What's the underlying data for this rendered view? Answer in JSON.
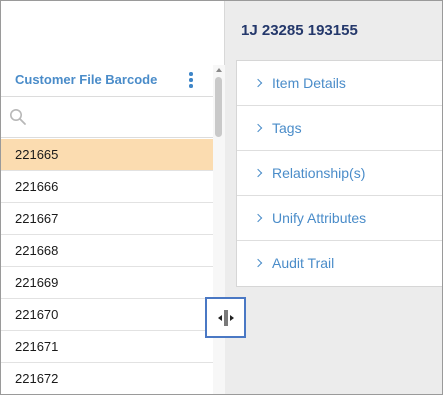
{
  "left_panel": {
    "column_title": "Customer File Barcode",
    "search": {
      "placeholder": "",
      "value": ""
    },
    "rows": [
      "221665",
      "221666",
      "221667",
      "221668",
      "221669",
      "221670",
      "221671",
      "221672"
    ],
    "selected_index": 0
  },
  "right_panel": {
    "record_title": "1J 23285 193155",
    "sections": [
      {
        "label": "Item Details"
      },
      {
        "label": "Tags"
      },
      {
        "label": "Relationship(s)"
      },
      {
        "label": "Unify Attributes"
      },
      {
        "label": "Audit Trail"
      }
    ]
  },
  "icons": {
    "search": "search-icon",
    "kebab": "kebab-menu-icon",
    "chevron": "chevron-right-icon",
    "resize": "column-resize-icon"
  },
  "colors": {
    "accent": "#4a8cc9",
    "title": "#24386b",
    "selected_row": "#fbdcb0",
    "highlight_border": "#4a78c4"
  }
}
